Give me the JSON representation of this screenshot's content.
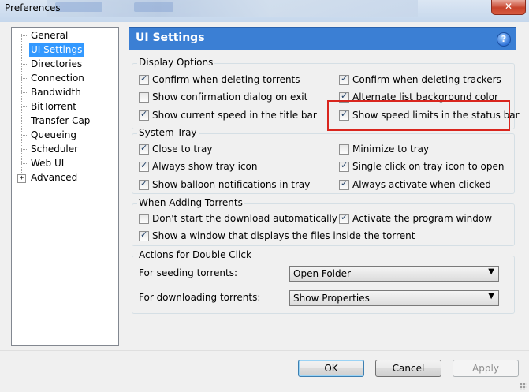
{
  "window": {
    "title": "Preferences",
    "close_glyph": "✕"
  },
  "tree": {
    "items": [
      {
        "label": "General"
      },
      {
        "label": "UI Settings",
        "selected": true
      },
      {
        "label": "Directories"
      },
      {
        "label": "Connection"
      },
      {
        "label": "Bandwidth"
      },
      {
        "label": "BitTorrent"
      },
      {
        "label": "Transfer Cap"
      },
      {
        "label": "Queueing"
      },
      {
        "label": "Scheduler"
      },
      {
        "label": "Web UI"
      },
      {
        "label": "Advanced",
        "expander": "+"
      }
    ]
  },
  "header": {
    "title": "UI Settings",
    "help_glyph": "?"
  },
  "display_options": {
    "legend": "Display Options",
    "items": [
      {
        "label": "Confirm when deleting torrents",
        "checked": true
      },
      {
        "label": "Confirm when deleting trackers",
        "checked": true
      },
      {
        "label": "Show confirmation dialog on exit",
        "checked": false
      },
      {
        "label": "Alternate list background color",
        "checked": true
      },
      {
        "label": "Show current speed in the title bar",
        "checked": true
      },
      {
        "label": "Show speed limits in the status bar",
        "checked": true
      }
    ]
  },
  "system_tray": {
    "legend": "System Tray",
    "items": [
      {
        "label": "Close to tray",
        "checked": true
      },
      {
        "label": "Minimize to tray",
        "checked": false
      },
      {
        "label": "Always show tray icon",
        "checked": true
      },
      {
        "label": "Single click on tray icon to open",
        "checked": true
      },
      {
        "label": "Show balloon notifications in tray",
        "checked": true
      },
      {
        "label": "Always activate when clicked",
        "checked": true
      }
    ]
  },
  "adding": {
    "legend": "When Adding Torrents",
    "items": [
      {
        "label": "Don't start the download automatically",
        "checked": false
      },
      {
        "label": "Activate the program window",
        "checked": true
      },
      {
        "label": "Show a window that displays the files inside the torrent",
        "checked": true
      }
    ]
  },
  "double_click": {
    "legend": "Actions for Double Click",
    "seeding_label": "For seeding torrents:",
    "seeding_value": "Open Folder",
    "downloading_label": "For downloading torrents:",
    "downloading_value": "Show Properties"
  },
  "buttons": {
    "ok": "OK",
    "cancel": "Cancel",
    "apply": "Apply"
  },
  "colors": {
    "header": "#3b7fd4",
    "selection": "#3399ff",
    "highlight_box": "#d9251d"
  }
}
